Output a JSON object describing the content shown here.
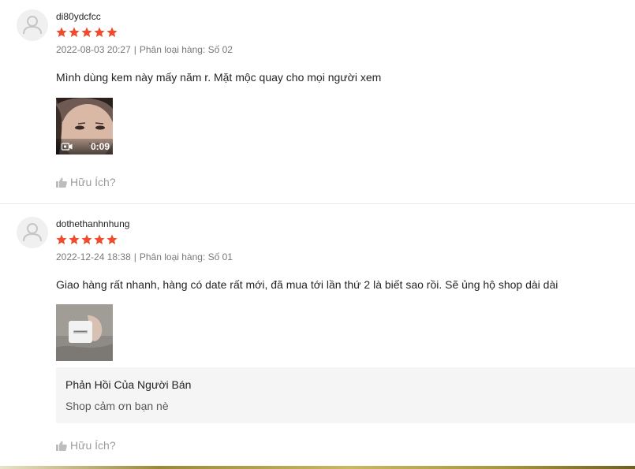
{
  "reviews": [
    {
      "username": "di80ydcfcc",
      "rating": 5,
      "date": "2022-08-03 20:27",
      "separator": "|",
      "variation": "Phân loại hàng: Số 02",
      "comment": "Mình dùng kem này mấy năm r. Mặt mộc quay cho mọi người xem",
      "media": {
        "type": "video",
        "duration": "0:09",
        "icon": "video-camera-icon"
      },
      "helpful_label": "Hữu Ích?"
    },
    {
      "username": "dothethanhnhung",
      "rating": 5,
      "date": "2022-12-24 18:38",
      "separator": "|",
      "variation": "Phân loại hàng: Số 01",
      "comment": "Giao hàng rất nhanh, hàng có date rất mới, đã mua tới lần thứ 2 là biết sao rồi. Sẽ ủng hộ shop dài dài",
      "media": {
        "type": "image"
      },
      "seller_reply": {
        "title": "Phản Hồi Của Người Bán",
        "text": "Shop cảm ơn bạn nè"
      },
      "helpful_label": "Hữu Ích?"
    }
  ],
  "colors": {
    "star": "#ee4d2d",
    "reply_bg": "#f5f5f5",
    "divider": "#e8e8e8"
  }
}
